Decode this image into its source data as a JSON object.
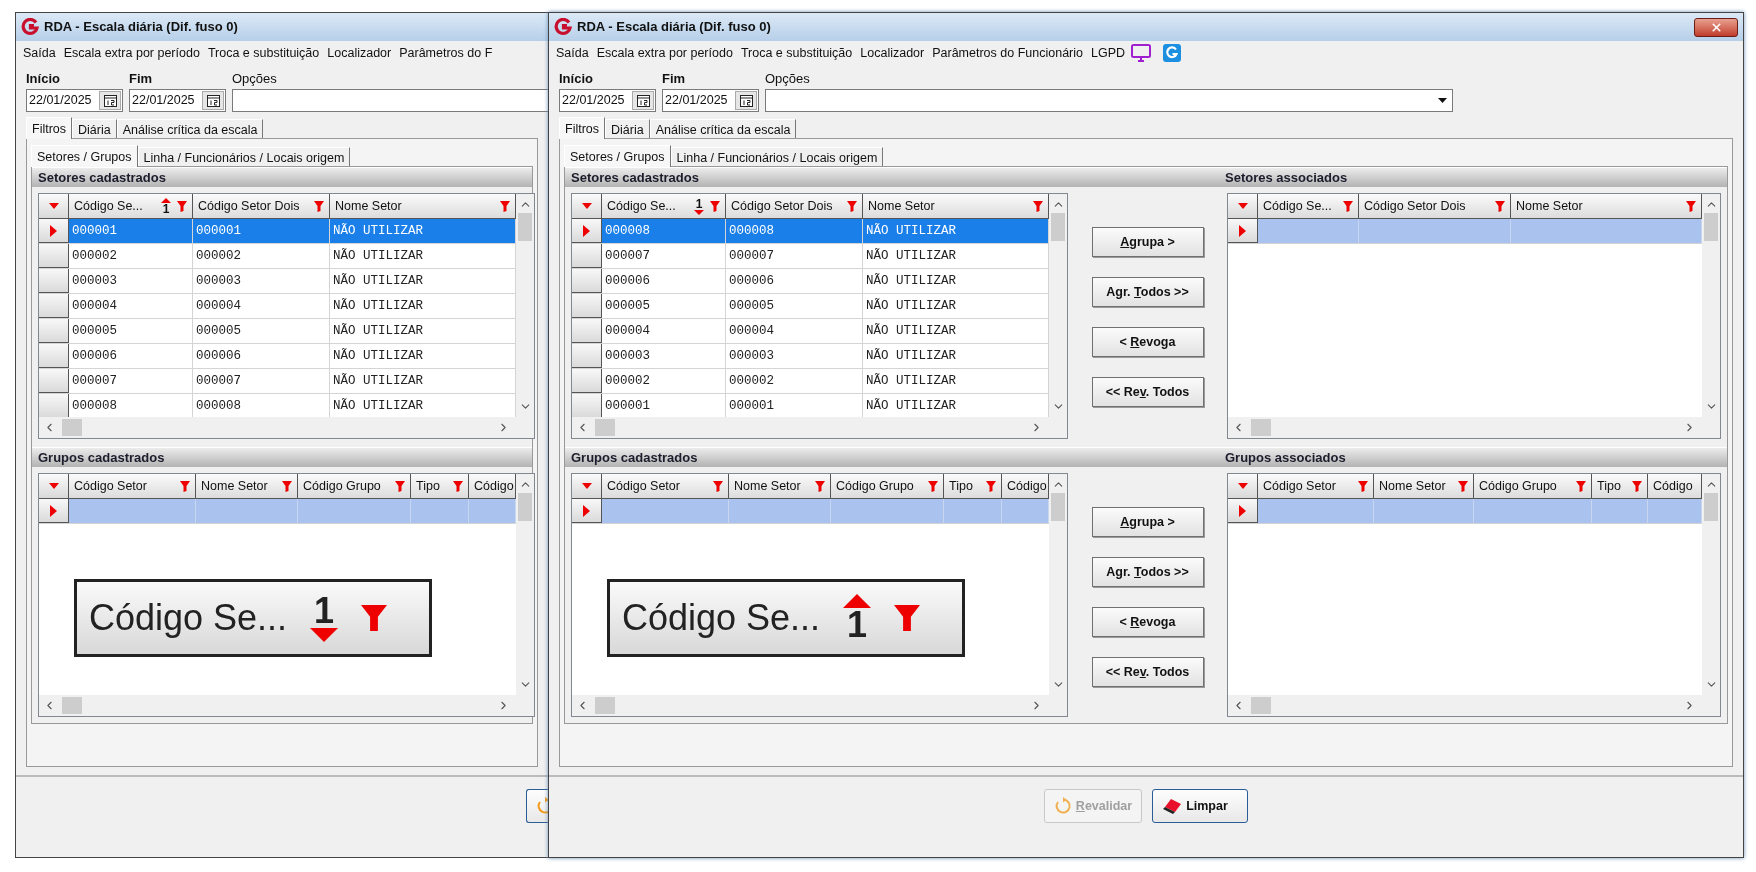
{
  "windows": [
    {
      "kind": "back",
      "title": "RDA - Escala diária (Dif. fuso 0)",
      "menu": [
        "Saída",
        "Escala extra por período",
        "Troca e substituição",
        "Localizador",
        "Parâmetros do F"
      ],
      "start": {
        "label": "Início",
        "value": "22/01/2025"
      },
      "end": {
        "label": "Fim",
        "value": "22/01/2025"
      },
      "options": {
        "label": "Opções"
      },
      "tabs": [
        {
          "label": "Filtros",
          "selected": true
        },
        {
          "label": "Diária",
          "selected": false
        },
        {
          "label": "Análise crítica da escala",
          "selected": false
        }
      ],
      "subtabs": [
        {
          "label": "Setores / Grupos",
          "selected": true
        },
        {
          "label": "Linha / Funcionários / Locais origem",
          "selected": false
        }
      ],
      "setores": {
        "title": "Setores cadastrados",
        "columns": [
          {
            "label": "Código Se...",
            "sort": "1",
            "sort_descending": false
          },
          {
            "label": "Código Setor Dois"
          },
          {
            "label": "Nome Setor"
          }
        ],
        "rows": [
          {
            "selected": true,
            "cells": [
              "000001",
              "000001",
              "NÃO UTILIZAR"
            ]
          },
          {
            "selected": false,
            "cells": [
              "000002",
              "000002",
              "NÃO UTILIZAR"
            ]
          },
          {
            "selected": false,
            "cells": [
              "000003",
              "000003",
              "NÃO UTILIZAR"
            ]
          },
          {
            "selected": false,
            "cells": [
              "000004",
              "000004",
              "NÃO UTILIZAR"
            ]
          },
          {
            "selected": false,
            "cells": [
              "000005",
              "000005",
              "NÃO UTILIZAR"
            ]
          },
          {
            "selected": false,
            "cells": [
              "000006",
              "000006",
              "NÃO UTILIZAR"
            ]
          },
          {
            "selected": false,
            "cells": [
              "000007",
              "000007",
              "NÃO UTILIZAR"
            ]
          },
          {
            "selected": false,
            "cells": [
              "000008",
              "000008",
              "NÃO UTILIZAR"
            ]
          }
        ]
      },
      "grupos": {
        "title": "Grupos cadastrados",
        "columns": [
          {
            "label": "Código Setor"
          },
          {
            "label": "Nome Setor"
          },
          {
            "label": "Código Grupo"
          },
          {
            "label": "Tipo"
          },
          {
            "label": "Código"
          }
        ],
        "rows": [
          {
            "selected": true
          }
        ],
        "callout": {
          "label": "Código Se...",
          "sort": "1",
          "sort_descending": true
        }
      },
      "bottom_buttons": [
        {
          "kind": "refresh",
          "disabled": false
        }
      ]
    },
    {
      "kind": "front",
      "title": "RDA - Escala diária (Dif. fuso 0)",
      "menu": [
        "Saída",
        "Escala extra por período",
        "Troca e substituição",
        "Localizador",
        "Parâmetros do Funcionário",
        "LGPD"
      ],
      "start": {
        "label": "Início",
        "value": "22/01/2025"
      },
      "end": {
        "label": "Fim",
        "value": "22/01/2025"
      },
      "options": {
        "label": "Opções"
      },
      "tabs": [
        {
          "label": "Filtros",
          "selected": true
        },
        {
          "label": "Diária",
          "selected": false
        },
        {
          "label": "Análise crítica da escala",
          "selected": false
        }
      ],
      "subtabs": [
        {
          "label": "Setores / Grupos",
          "selected": true
        },
        {
          "label": "Linha / Funcionários / Locais origem",
          "selected": false
        }
      ],
      "setores": {
        "title": "Setores cadastrados",
        "columns": [
          {
            "label": "Código Se...",
            "sort": "1",
            "sort_descending": true
          },
          {
            "label": "Código Setor Dois"
          },
          {
            "label": "Nome Setor"
          }
        ],
        "rows": [
          {
            "selected": true,
            "cells": [
              "000008",
              "000008",
              "NÃO UTILIZAR"
            ]
          },
          {
            "selected": false,
            "cells": [
              "000007",
              "000007",
              "NÃO UTILIZAR"
            ]
          },
          {
            "selected": false,
            "cells": [
              "000006",
              "000006",
              "NÃO UTILIZAR"
            ]
          },
          {
            "selected": false,
            "cells": [
              "000005",
              "000005",
              "NÃO UTILIZAR"
            ]
          },
          {
            "selected": false,
            "cells": [
              "000004",
              "000004",
              "NÃO UTILIZAR"
            ]
          },
          {
            "selected": false,
            "cells": [
              "000003",
              "000003",
              "NÃO UTILIZAR"
            ]
          },
          {
            "selected": false,
            "cells": [
              "000002",
              "000002",
              "NÃO UTILIZAR"
            ]
          },
          {
            "selected": false,
            "cells": [
              "000001",
              "000001",
              "NÃO UTILIZAR"
            ]
          }
        ]
      },
      "setores_transfer_buttons": [
        {
          "key": "A",
          "after": "grupa >"
        },
        {
          "before": "Agr. ",
          "key": "T",
          "after": "odos >>"
        },
        {
          "before": "< ",
          "key": "R",
          "after": "evoga"
        },
        {
          "before": "<< Re",
          "key": "v",
          "after": ". Todos"
        }
      ],
      "setores_associados": {
        "title": "Setores associados",
        "columns": [
          {
            "label": "Código Se..."
          },
          {
            "label": "Código Setor Dois"
          },
          {
            "label": "Nome Setor"
          }
        ],
        "rows": [
          {
            "selected": true
          }
        ]
      },
      "grupos": {
        "title": "Grupos cadastrados",
        "columns": [
          {
            "label": "Código Setor"
          },
          {
            "label": "Nome Setor"
          },
          {
            "label": "Código Grupo"
          },
          {
            "label": "Tipo"
          },
          {
            "label": "Código"
          }
        ],
        "rows": [
          {
            "selected": true
          }
        ],
        "callout": {
          "label": "Código Se...",
          "sort": "1",
          "sort_descending": false
        }
      },
      "grupos_transfer_buttons": [
        {
          "key": "A",
          "after": "grupa >"
        },
        {
          "before": "Agr. ",
          "key": "T",
          "after": "odos >>"
        },
        {
          "before": "< ",
          "key": "R",
          "after": "evoga"
        },
        {
          "before": "<< Re",
          "key": "v",
          "after": ". Todos"
        }
      ],
      "grupos_associados": {
        "title": "Grupos associados",
        "columns": [
          {
            "label": "Código Setor"
          },
          {
            "label": "Nome Setor"
          },
          {
            "label": "Código Grupo"
          },
          {
            "label": "Tipo"
          },
          {
            "label": "Código"
          }
        ],
        "rows": [
          {
            "selected": true
          }
        ]
      },
      "bottom_buttons": [
        {
          "key": "R",
          "after": "evalidar",
          "kind": "refresh",
          "disabled": true
        },
        {
          "label": "Limpar",
          "kind": "eraser",
          "disabled": false
        }
      ]
    }
  ]
}
